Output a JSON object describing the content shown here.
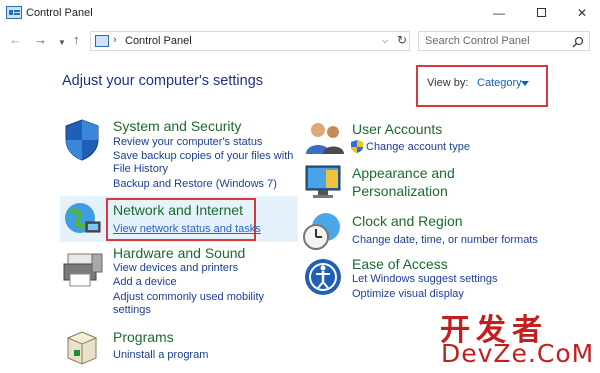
{
  "window": {
    "title": "Control Panel"
  },
  "nav": {
    "breadcrumb": "Control Panel",
    "search_placeholder": "Search Control Panel"
  },
  "content": {
    "heading": "Adjust your computer's settings",
    "view_by_label": "View by:",
    "view_by_value": "Category"
  },
  "categories": {
    "system": {
      "title": "System and Security",
      "links": [
        "Review your computer's status",
        "Save backup copies of your files with",
        "File History",
        "Backup and Restore (Windows 7)"
      ]
    },
    "network": {
      "title": "Network and Internet",
      "links": [
        "View network status and tasks"
      ]
    },
    "hardware": {
      "title": "Hardware and Sound",
      "links": [
        "View devices and printers",
        "Add a device",
        "Adjust commonly used mobility",
        "settings"
      ]
    },
    "programs": {
      "title": "Programs",
      "links": [
        "Uninstall a program"
      ]
    },
    "users": {
      "title": "User Accounts",
      "links": [
        "Change account type"
      ]
    },
    "appearance": {
      "title_line1": "Appearance and",
      "title_line2": "Personalization"
    },
    "clock": {
      "title": "Clock and Region",
      "links": [
        "Change date, time, or number formats"
      ]
    },
    "ease": {
      "title": "Ease of Access",
      "links": [
        "Let Windows suggest settings",
        "Optimize visual display"
      ]
    }
  },
  "watermark": {
    "line1": "开发者",
    "line2": "DevZe.CoM"
  },
  "colors": {
    "heading": "#1e3287",
    "category_title": "#1a6b2e",
    "link": "#1c3f94",
    "highlight_box": "#d63a3a",
    "watermark": "#c22020"
  }
}
